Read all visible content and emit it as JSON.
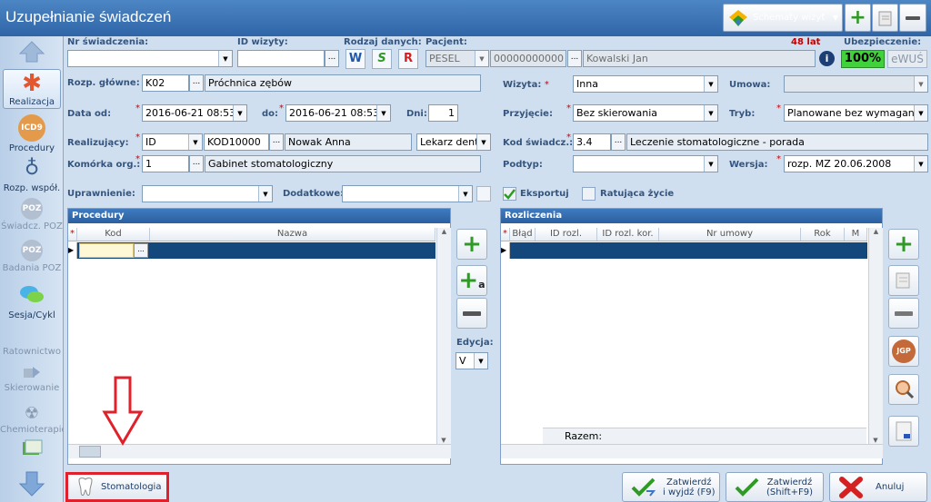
{
  "window": {
    "title": "Uzupełnianie świadczeń"
  },
  "toolbar": {
    "schematy_label": "Schematy wizyt"
  },
  "sidebar": {
    "items": [
      {
        "label": "Realizacja"
      },
      {
        "label": "Procedury"
      },
      {
        "label": "Rozp. współ."
      },
      {
        "label": "Świadcz. POZ"
      },
      {
        "label": "Badania POZ"
      },
      {
        "label": "Sesja/Cykl"
      },
      {
        "label": "Ratownictwo"
      },
      {
        "label": "Skierowanie"
      },
      {
        "label": "Chemioterapio"
      }
    ],
    "icd9_icon_text": "ICD9",
    "poz_icon_text": "POZ"
  },
  "header": {
    "nr_label": "Nr świadczenia:",
    "id_wizyty_label": "ID wizyty:",
    "rodzaj_label": "Rodzaj danych:",
    "rodzaj_buttons": [
      "W",
      "S",
      "R"
    ],
    "pacjent_label": "Pacjent:",
    "wiek": "48 lat",
    "ubezp_label": "Ubezpieczenie:",
    "pacjent_id_type": "PESEL",
    "pesel": "00000000000",
    "pacjent_name": "Kowalski Jan",
    "ubezp_value": "100%",
    "ewus": "eWUŚ"
  },
  "form": {
    "rozp_label": "Rozp. główne:",
    "rozp_code": "K02",
    "rozp_name": "Próchnica zębów",
    "wizyta_label": "Wizyta:",
    "wizyta_value": "Inna",
    "umowa_label": "Umowa:",
    "data_od_label": "Data od:",
    "data_od": "2016-06-21 08:53",
    "do_label": "do:",
    "data_do": "2016-06-21 08:53",
    "dni_label": "Dni:",
    "dni": "1",
    "przyjecie_label": "Przyjęcie:",
    "przyjecie_value": "Bez skierowania",
    "tryb_label": "Tryb:",
    "tryb_value": "Planowane bez wymagania",
    "realiz_label": "Realizujący:",
    "realiz_type": "ID",
    "realiz_code": "KOD10000",
    "realiz_name": "Nowak Anna",
    "realiz_role": "Lekarz denty",
    "kod_label": "Kod świadcz.:",
    "kod_value": "3.4",
    "kod_name": "Leczenie stomatologiczne - porada",
    "komorka_label": "Komórka org.:",
    "komorka_code": "1",
    "komorka_name": "Gabinet stomatologiczny",
    "podtyp_label": "Podtyp:",
    "wersja_label": "Wersja:",
    "wersja_value": "rozp. MZ 20.06.2008",
    "uprawnienie_label": "Uprawnienie:",
    "dodatkowe_label": "Dodatkowe:",
    "eksportuj_label": "Eksportuj",
    "ratujaca_label": "Ratująca życie"
  },
  "procedury": {
    "title": "Procedury",
    "columns": [
      "Kod",
      "Nazwa"
    ],
    "edycja_label": "Edycja:",
    "edycja_value": "V"
  },
  "rozliczenia": {
    "title": "Rozliczenia",
    "columns": [
      "Błąd",
      "ID rozl.",
      "ID rozl. kor.",
      "Nr umowy",
      "Rok",
      "M"
    ],
    "razem_label": "Razem:",
    "jgp_text": "JGP"
  },
  "bottom": {
    "stomatologia": "Stomatologia",
    "zatwierdz_wyjdz": "Zatwierdź\ni wyjdź (F9)",
    "zatwierdz": "Zatwierdź\n(Shift+F9)",
    "anuluj": "Anuluj"
  },
  "colors": {
    "annotation_red": "#e0202a",
    "accent": "#2f65a7"
  }
}
